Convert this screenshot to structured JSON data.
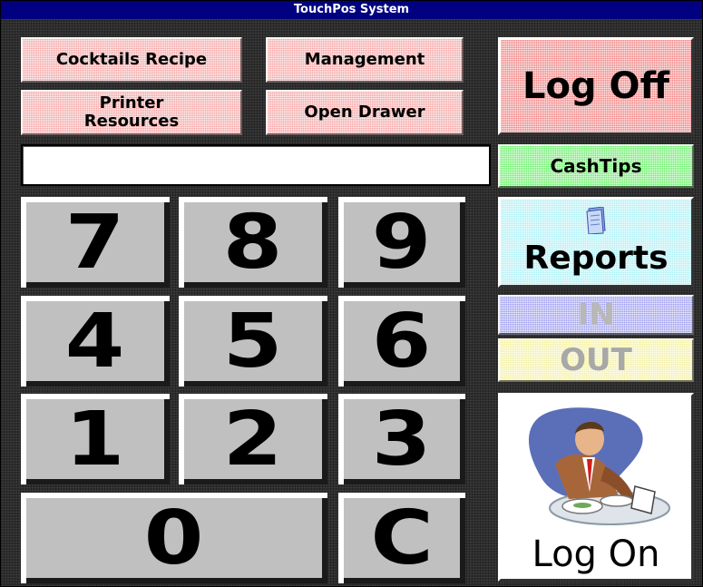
{
  "window": {
    "title": "TouchPos System"
  },
  "top_buttons": {
    "cocktails_recipe": "Cocktails Recipe",
    "management": "Management",
    "printer_resources_line1": "Printer",
    "printer_resources_line2": "Resources",
    "open_drawer": "Open Drawer"
  },
  "side_buttons": {
    "log_off": "Log Off",
    "cash_tips": "CashTips",
    "reports": "Reports",
    "clock_in": "IN",
    "clock_out": "OUT",
    "log_on": "Log On"
  },
  "display": {
    "value": ""
  },
  "keypad": {
    "k7": "7",
    "k8": "8",
    "k9": "9",
    "k4": "4",
    "k5": "5",
    "k6": "6",
    "k1": "1",
    "k2": "2",
    "k3": "3",
    "k0": "0",
    "clear": "C"
  },
  "colors": {
    "title_bar": "#000080",
    "pink_buttons": "#f4a3a3",
    "log_off": "#f08080",
    "cash_tips": "#66ee66",
    "reports": "#aaf0f5",
    "in": "#9999ee",
    "out": "#f3f0a0",
    "keypad": "#c0c0c0"
  },
  "icons": {
    "reports": "document-icon",
    "log_on": "businessman-dining-icon"
  }
}
